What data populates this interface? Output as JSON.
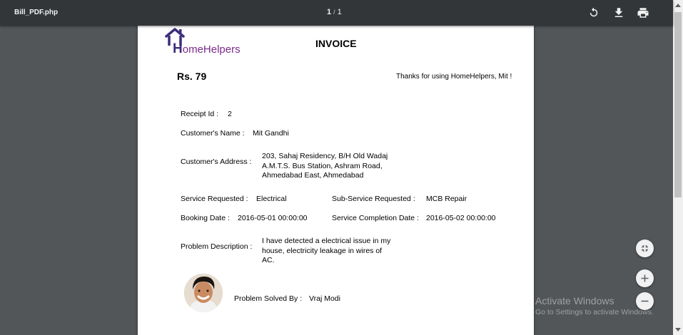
{
  "viewer": {
    "file_title": "Bill_PDF.php",
    "current_page": "1",
    "separator": "/",
    "total_pages": "1"
  },
  "invoice": {
    "logo_initial": "H",
    "logo_rest": "omeHelpers",
    "title": "INVOICE",
    "amount": "Rs. 79",
    "thanks": "Thanks for using HomeHelpers, Mit !",
    "receipt_label": "Receipt Id :",
    "receipt_value": "2",
    "customer_name_label": "Customer's Name :",
    "customer_name_value": "Mit Gandhi",
    "customer_address_label": "Customer's Address :",
    "customer_address_value": "203, Sahaj Residency, B/H Old Wadaj A.M.T.S. Bus Station, Ashram Road, Ahmedabad East, Ahmedabad",
    "service_label": "Service Requested :",
    "service_value": "Electrical",
    "subservice_label": "Sub-Service Requested :",
    "subservice_value": "MCB Repair",
    "booking_label": "Booking Date :",
    "booking_value": "2016-05-01 00:00:00",
    "completion_label": "Service Completion Date :",
    "completion_value": "2016-05-02 00:00:00",
    "problem_label": "Problem Description :",
    "problem_value": "I have detected a electrical issue in my house, electricity leakage in wires of AC.",
    "solved_by_label": "Problem Solved By :",
    "solved_by_value": "Vraj Modi"
  },
  "watermark": {
    "line1": "Activate Windows",
    "line2": "Go to Settings to activate Windows."
  },
  "icons": {
    "rotate": "rotate-icon",
    "download": "download-icon",
    "print": "print-icon",
    "fit": "fit-to-page-icon",
    "zoom_in": "zoom-in-icon",
    "zoom_out": "zoom-out-icon"
  },
  "colors": {
    "toolbar": "#323639",
    "viewer_background": "#525659",
    "logo_purple": "#7b2b8b",
    "logo_indigo": "#3e2d7a"
  }
}
